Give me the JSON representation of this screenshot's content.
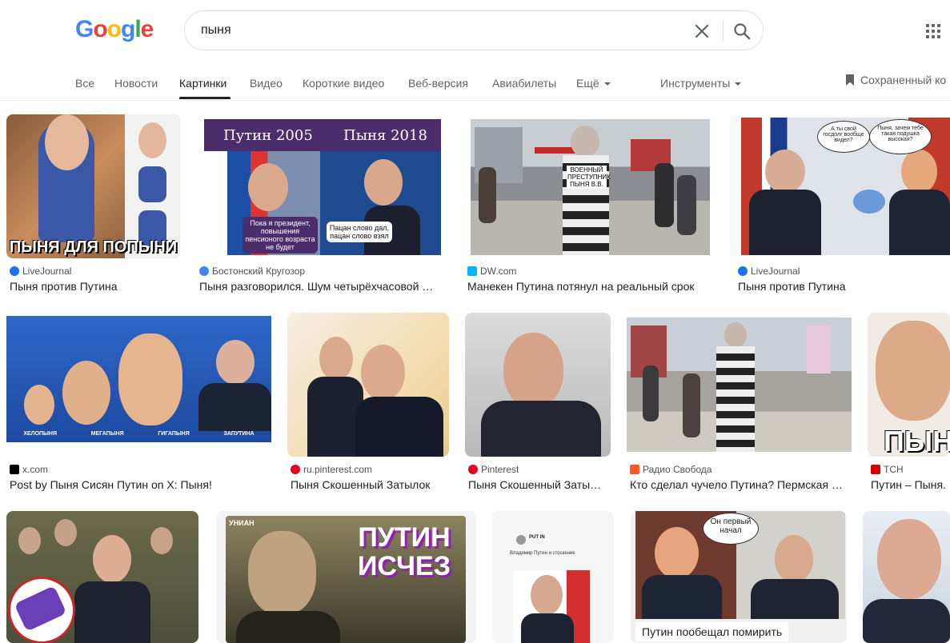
{
  "header": {
    "logo": "Google",
    "query": "пыня"
  },
  "tabs": {
    "all": "Все",
    "news": "Новости",
    "images": "Картинки",
    "video": "Видео",
    "shorts": "Короткие видео",
    "web": "Веб-версия",
    "flights": "Авиабилеты",
    "more": "Ещё",
    "tools": "Инструменты",
    "saved": "Сохраненный ко"
  },
  "results": [
    {
      "source": "LiveJournal",
      "title": "Пыня против Путина",
      "overlay": "ПЫНЯ ДЛЯ ПОПЫНИ",
      "fav_color": "#1a73e8"
    },
    {
      "source": "Бостонский Кругозор",
      "title": "Пыня разговорился. Шум четырёхчасовой …",
      "overlay_left": "Путин 2005",
      "overlay_right": "Пыня 2018",
      "bubble1": "Пока я президент, повышения пенсионого возраста не будет",
      "bubble2": "Пацан слово дал, пацан слово взял",
      "fav_color": "#4285f4"
    },
    {
      "source": "DW.com",
      "title": "Манекен Путина потянул на реальный срок",
      "sign": "ВОЕННЫЙ ПРЕСТУПНИК ПЫНЯ В.В.",
      "fav_color": "#05b2fc"
    },
    {
      "source": "LiveJournal",
      "title": "Пыня против Путина",
      "bubble1": "А ты свой госдолг вообще видел?",
      "bubble2": "Пыня, зачем тебе такая подушка высокая?",
      "fav_color": "#1a73e8"
    },
    {
      "source": "x.com",
      "title": "Post by Пыня Сисян Путин on X: Пыня!",
      "labels": [
        "ХЕЛОПЫНЯ",
        "МЕГАПЫНЯ",
        "ГИГАПЫНЯ",
        "ЗАПУТИНА"
      ],
      "fav_color": "#000000"
    },
    {
      "source": "ru.pinterest.com",
      "title": "Пыня Скошенный Затылок",
      "fav_color": "#e60023"
    },
    {
      "source": "Pinterest",
      "title": "Пыня Скошенный Заты…",
      "fav_color": "#e60023"
    },
    {
      "source": "Радио Свобода",
      "title": "Кто сделал чучело Путина? Пермская …",
      "fav_color": "#ff5722"
    },
    {
      "source": "TCH",
      "title": "Путин – Пыня. …",
      "overlay": "ПЫНЯ",
      "fav_color": "#d50000"
    },
    {
      "overlay": "",
      "fav_color": "#ffffff"
    },
    {
      "overlay": "ПУТИН ИСЧЕЗ",
      "brand": "УНИАН"
    },
    {
      "post_name": "PUT IN",
      "post_text": "Владимир Путин и стоскение"
    },
    {
      "bubble": "Он первый начал",
      "caption": "Путин пообещал помирить"
    },
    {}
  ]
}
